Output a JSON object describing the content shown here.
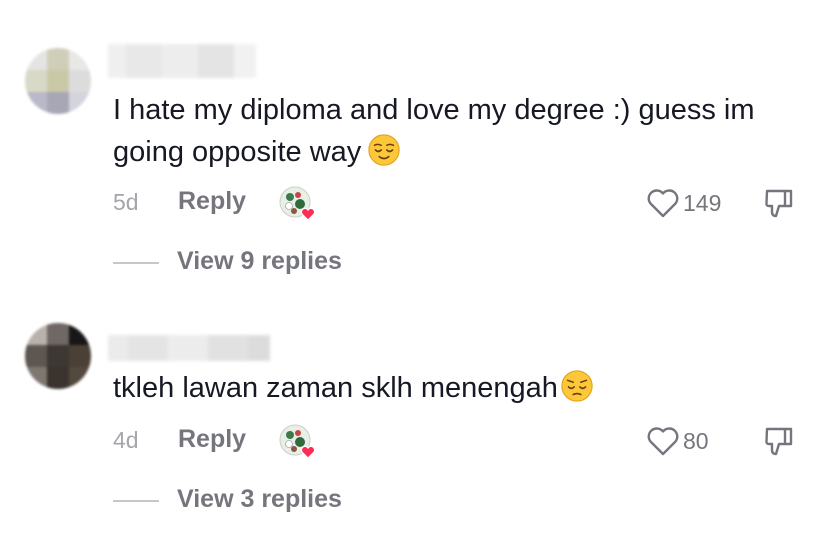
{
  "comments": [
    {
      "text": "I hate my diploma and love my degree :) guess im going opposite way",
      "emoji": "relieved-face-icon",
      "time": "5d",
      "reply_label": "Reply",
      "likes": "149",
      "view_replies": "View 9 replies",
      "creator_liked": true
    },
    {
      "text": "tkleh lawan zaman sklh menengah",
      "emoji": "pensive-face-icon",
      "time": "4d",
      "reply_label": "Reply",
      "likes": "80",
      "view_replies": "View 3 replies",
      "creator_liked": true
    }
  ],
  "colors": {
    "text": "#161823",
    "muted": "#75767d",
    "timestamp": "#a5a6ab",
    "heart": "#fe2c55"
  }
}
